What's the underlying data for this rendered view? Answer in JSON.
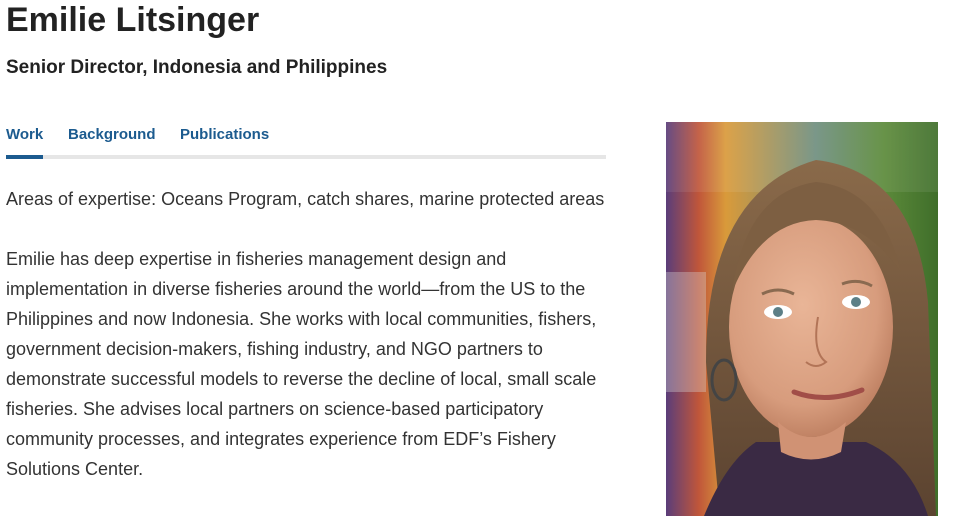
{
  "profile": {
    "name": "Emilie Litsinger",
    "title": "Senior Director, Indonesia and Philippines"
  },
  "tabs": [
    {
      "label": "Work",
      "active": true
    },
    {
      "label": "Background",
      "active": false
    },
    {
      "label": "Publications",
      "active": false
    }
  ],
  "content": {
    "expertise": "Areas of expertise: Oceans Program, catch shares, marine protected areas",
    "bio": "Emilie has deep expertise in fisheries management design and implementation in diverse fisheries around the world—from the US to the Philippines and now Indonesia. She works with local communities, fishers, government decision-makers, fishing industry, and NGO partners to demonstrate successful models to reverse the decline of local, small scale fisheries. She advises local partners on science-based participatory community processes, and integrates experience from EDF’s Fishery Solutions Center."
  },
  "colors": {
    "accent": "#1c5b8f",
    "text": "#222222",
    "tab_rule": "#e6e6e6"
  }
}
